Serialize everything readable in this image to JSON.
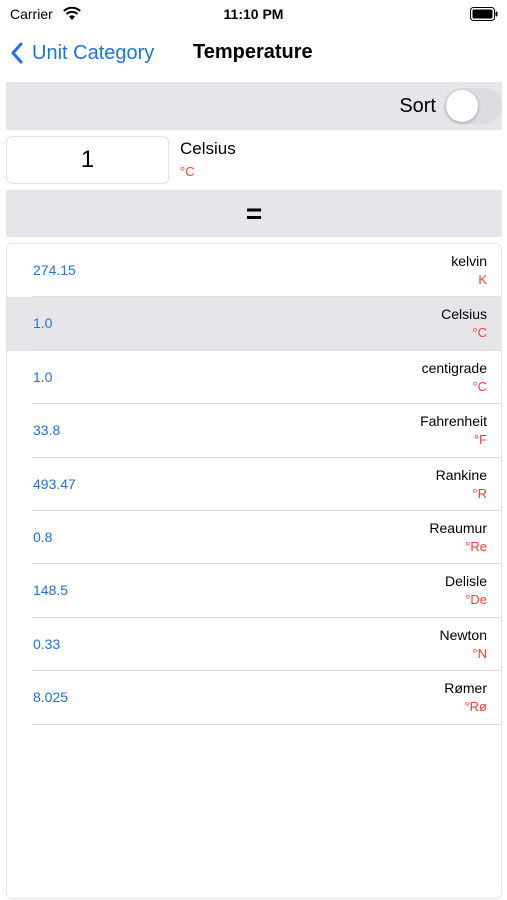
{
  "status_bar": {
    "carrier": "Carrier",
    "time": "11:10 PM"
  },
  "nav": {
    "back_label": "Unit Category",
    "title": "Temperature"
  },
  "sort": {
    "label": "Sort",
    "enabled": false
  },
  "source": {
    "value": "1",
    "unit_name": "Celsius",
    "unit_symbol": "°C"
  },
  "equals": "=",
  "results": [
    {
      "value": "274.15",
      "unit": "kelvin",
      "symbol": "K",
      "selected": false
    },
    {
      "value": "1.0",
      "unit": "Celsius",
      "symbol": "°C",
      "selected": true
    },
    {
      "value": "1.0",
      "unit": "centigrade",
      "symbol": "°C",
      "selected": false
    },
    {
      "value": "33.8",
      "unit": "Fahrenheit",
      "symbol": "°F",
      "selected": false
    },
    {
      "value": "493.47",
      "unit": "Rankine",
      "symbol": "°R",
      "selected": false
    },
    {
      "value": "0.8",
      "unit": "Reaumur",
      "symbol": "°Re",
      "selected": false
    },
    {
      "value": "148.5",
      "unit": "Delisle",
      "symbol": "°De",
      "selected": false
    },
    {
      "value": "0.33",
      "unit": "Newton",
      "symbol": "°N",
      "selected": false
    },
    {
      "value": "8.025",
      "unit": "Rømer",
      "symbol": "°Rø",
      "selected": false
    }
  ],
  "colors": {
    "accent": "#1a73e8",
    "symbol": "#ff3b30",
    "bar_background": "#e5e5ea"
  },
  "icons": {
    "wifi": "wifi-icon",
    "battery": "battery-icon",
    "back": "chevron-left-icon"
  }
}
